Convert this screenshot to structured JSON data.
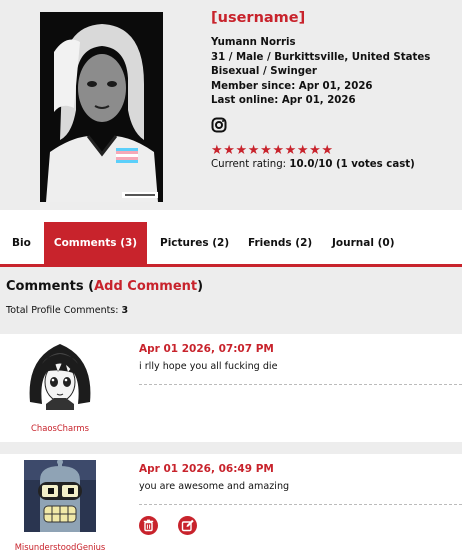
{
  "profile": {
    "username": "[username]",
    "real_name": "Yumann Norris",
    "age_gender_location": "31 / Male / Burkittsville, United States",
    "orientation_status": "Bisexual / Swinger",
    "member_since": "Member since: Apr 01, 2026",
    "last_online": "Last online: Apr 01, 2026",
    "social_icon": "instagram-icon",
    "rating_stars": 10,
    "rating_max": 10,
    "rating_label": "Current rating:",
    "rating_value": "10.0/10 (1 votes cast)"
  },
  "tabs": [
    {
      "label": "Bio",
      "active": false
    },
    {
      "label": "Comments (3)",
      "active": true
    },
    {
      "label": "Pictures (2)",
      "active": false
    },
    {
      "label": "Friends (2)",
      "active": false
    },
    {
      "label": "Journal (0)",
      "active": false
    }
  ],
  "comments_section": {
    "title": "Comments",
    "open_paren": "(",
    "add_link": "Add Comment",
    "close_paren": ")",
    "total_label": "Total Profile Comments:",
    "total_value": "3"
  },
  "comments": [
    {
      "author": "ChaosCharms",
      "date": "Apr 01 2026, 07:07 PM",
      "text": "i rlly hope you all fucking die",
      "avatar_icon": "anime-girl-avatar"
    },
    {
      "author": "MisunderstoodGenius",
      "date": "Apr 01 2026, 06:49 PM",
      "text": "you are awesome and amazing",
      "avatar_icon": "robot-avatar",
      "actions": [
        "delete-icon",
        "edit-icon"
      ]
    }
  ],
  "colors": {
    "accent": "#c8232c",
    "panel": "#ededed"
  }
}
